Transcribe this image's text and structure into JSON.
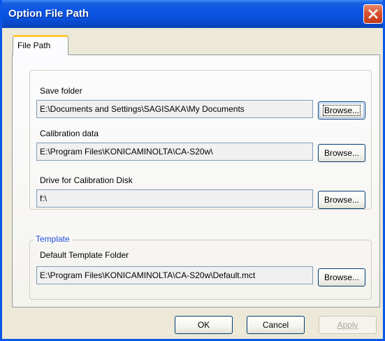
{
  "window": {
    "title": "Option File Path"
  },
  "tabs": [
    {
      "label": "File Path",
      "selected": true
    }
  ],
  "file_path": {
    "save_folder": {
      "label": "Save folder",
      "value": "E:\\Documents and Settings\\SAGISAKA\\My Documents",
      "browse_label": "Browse..."
    },
    "calibration_data": {
      "label": "Calibration data",
      "value": "E:\\Program Files\\KONICAMINOLTA\\CA-S20w\\",
      "browse_label": "Browse..."
    },
    "calibration_disk": {
      "label": "Drive for Calibration Disk",
      "value": "f:\\",
      "browse_label": "Browse..."
    }
  },
  "template": {
    "group_title": "Template",
    "default_folder": {
      "label": "Default Template Folder",
      "value": "E:\\Program Files\\KONICAMINOLTA\\CA-S20w\\Default.mct",
      "browse_label": "Browse..."
    }
  },
  "buttons": {
    "ok": "OK",
    "cancel": "Cancel",
    "apply": "Apply"
  },
  "icons": {
    "close": "close-icon"
  },
  "colors": {
    "titlebar": "#0a4fd8",
    "close_button": "#d8532f",
    "tab_highlight": "#ffc83c",
    "group_title": "#2250d8"
  }
}
